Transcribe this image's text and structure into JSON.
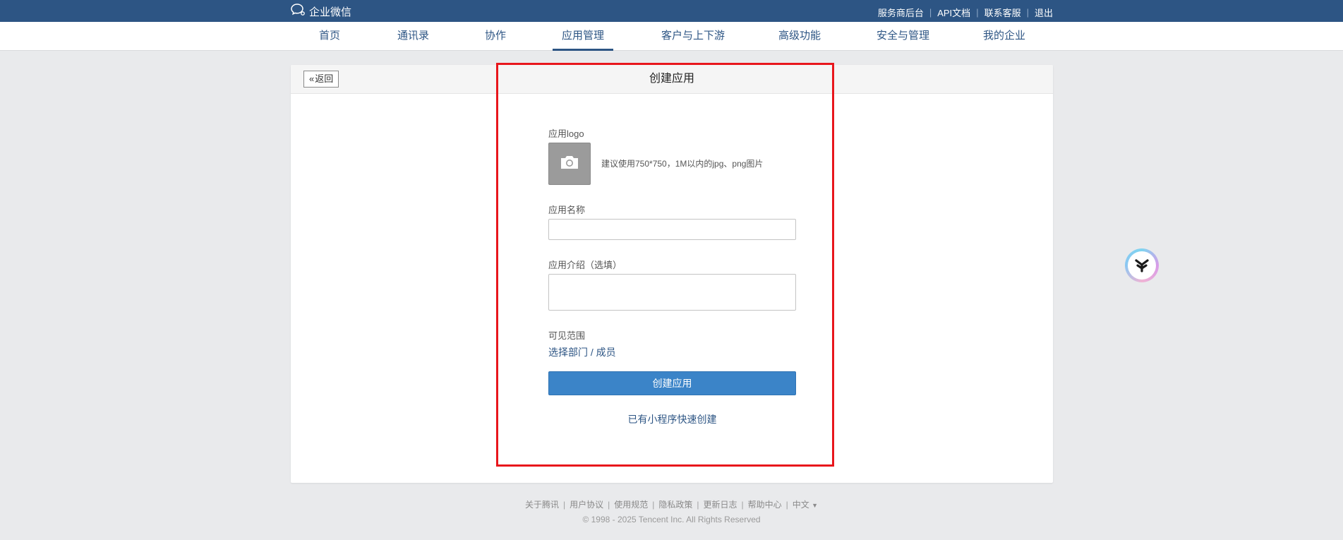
{
  "brand": {
    "name": "企业微信",
    "icon": "chat-bubble-icon"
  },
  "top_links": [
    "服务商后台",
    "API文档",
    "联系客服",
    "退出"
  ],
  "nav": {
    "items": [
      "首页",
      "通讯录",
      "协作",
      "应用管理",
      "客户与上下游",
      "高级功能",
      "安全与管理",
      "我的企业"
    ],
    "active": "应用管理"
  },
  "panel": {
    "back_label": "返回",
    "title": "创建应用"
  },
  "form": {
    "logo_label": "应用logo",
    "logo_hint": "建议使用750*750，1M以内的jpg、png图片",
    "name_label": "应用名称",
    "name_value": "",
    "intro_label": "应用介绍（选填）",
    "intro_value": "",
    "scope_label": "可见范围",
    "scope_link": "选择部门 / 成员",
    "submit_label": "创建应用",
    "mini_program_link": "已有小程序快速创建"
  },
  "footer": {
    "links": [
      "关于腾讯",
      "用户协议",
      "使用规范",
      "隐私政策",
      "更新日志",
      "帮助中心",
      "中文"
    ],
    "copyright": "© 1998 - 2025 Tencent Inc. All Rights Reserved"
  },
  "colors": {
    "topbar": "#2d5584",
    "accent": "#3b84c8",
    "highlight": "#e8161c"
  }
}
